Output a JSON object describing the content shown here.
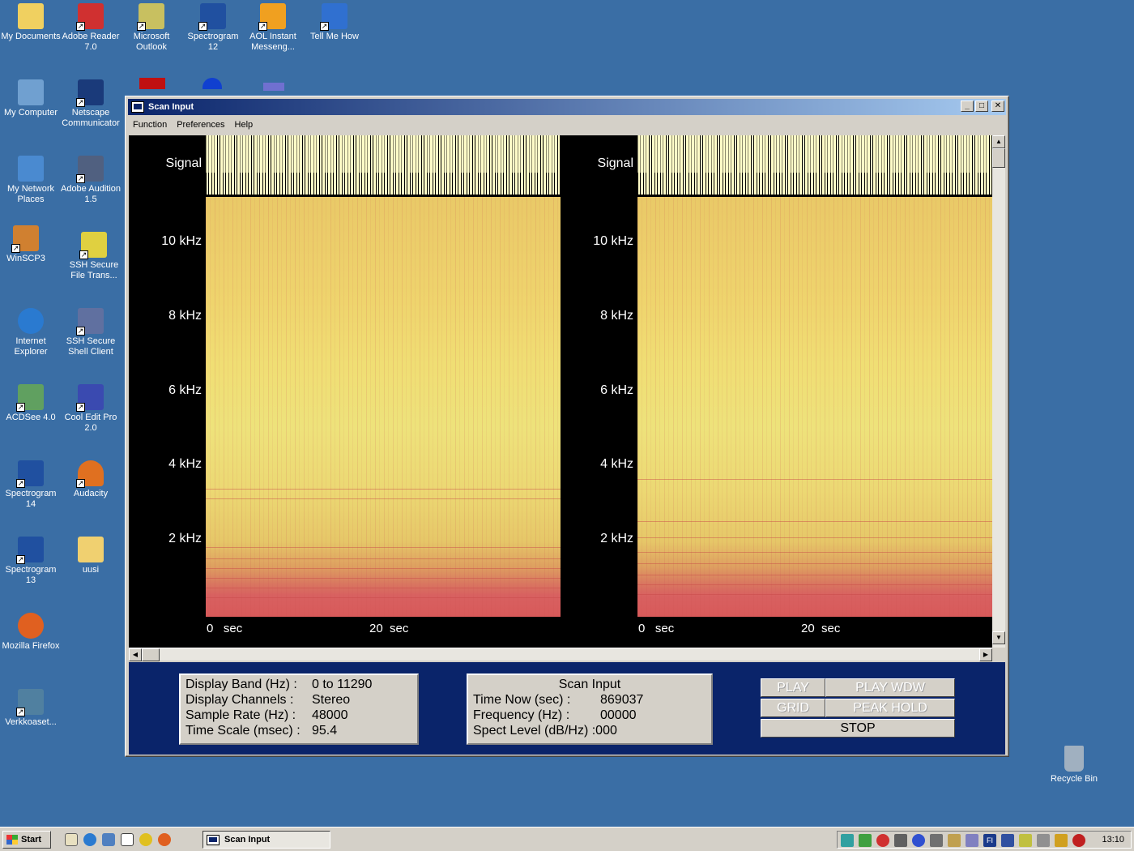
{
  "desktop": {
    "icons": [
      {
        "label": "My Documents",
        "color": "#f0d060"
      },
      {
        "label": "Adobe Reader 7.0",
        "color": "#d03030"
      },
      {
        "label": "Microsoft Outlook",
        "color": "#c8c060"
      },
      {
        "label": "Spectrogram 12",
        "color": "#2050a0"
      },
      {
        "label": "AOL Instant Messeng...",
        "color": "#f0a020"
      },
      {
        "label": "Tell Me How",
        "color": "#3070d0"
      },
      {
        "label": "My Computer",
        "color": "#70a0d0"
      },
      {
        "label": "Netscape Communicator",
        "color": "#1a3a7a"
      },
      {
        "label": "My Network Places",
        "color": "#4a8ad0"
      },
      {
        "label": "Adobe Audition 1.5",
        "color": "#506080"
      },
      {
        "label": "WinSCP3",
        "color": "#d08030"
      },
      {
        "label": "SSH Secure File Trans...",
        "color": "#e0d040"
      },
      {
        "label": "Internet Explorer",
        "color": "#2a7ad0"
      },
      {
        "label": "SSH Secure Shell Client",
        "color": "#6070a0"
      },
      {
        "label": "ACDSee 4.0",
        "color": "#60a060"
      },
      {
        "label": "Cool Edit Pro 2.0",
        "color": "#3a4ab0"
      },
      {
        "label": "Spectrogram 14",
        "color": "#2050a0"
      },
      {
        "label": "Audacity",
        "color": "#e07020"
      },
      {
        "label": "Spectrogram 13",
        "color": "#2050a0"
      },
      {
        "label": "uusi",
        "color": "#f0d070"
      },
      {
        "label": "Mozilla Firefox",
        "color": "#e06020"
      },
      {
        "label": "Verkkoaset...",
        "color": "#5080a0"
      },
      {
        "label": "Recycle Bin",
        "color": "#a0b0c0"
      }
    ]
  },
  "window": {
    "title": "Scan Input",
    "minimize": "_",
    "maximize": "□",
    "close": "✕",
    "menu": [
      "Function",
      "Preferences",
      "Help"
    ]
  },
  "panels": [
    {
      "signal_label": "Signal",
      "freq_labels": [
        "10 kHz",
        "8 kHz",
        "6 kHz",
        "4 kHz",
        "2 kHz"
      ],
      "time_labels": [
        {
          "num": "0",
          "unit": "sec"
        },
        {
          "num": "20",
          "unit": "sec"
        }
      ]
    },
    {
      "signal_label": "Signal",
      "freq_labels": [
        "10 kHz",
        "8 kHz",
        "6 kHz",
        "4 kHz",
        "2 kHz"
      ],
      "time_labels": [
        {
          "num": "0",
          "unit": "sec"
        },
        {
          "num": "20",
          "unit": "sec"
        }
      ]
    }
  ],
  "info": {
    "settings": [
      {
        "key": "Display Band (Hz) :",
        "value": "0 to 11290"
      },
      {
        "key": "Display Channels :",
        "value": "Stereo"
      },
      {
        "key": "Sample Rate (Hz) :",
        "value": "48000"
      },
      {
        "key": "Time Scale (msec) :",
        "value": "95.4"
      }
    ],
    "scan_title": "Scan Input",
    "scan": [
      {
        "key": "Time Now (sec) :",
        "value": "869037"
      },
      {
        "key": "Frequency (Hz) :",
        "value": "00000"
      },
      {
        "key": "Spect Level (dB/Hz) :",
        "value": "000"
      }
    ]
  },
  "controls": {
    "play": "PLAY",
    "play_wdw": "PLAY WDW",
    "grid": "GRID",
    "peak_hold": "PEAK HOLD",
    "stop": "STOP"
  },
  "taskbar": {
    "start": "Start",
    "task": "Scan Input",
    "lang": "FI",
    "clock": "13:10"
  }
}
